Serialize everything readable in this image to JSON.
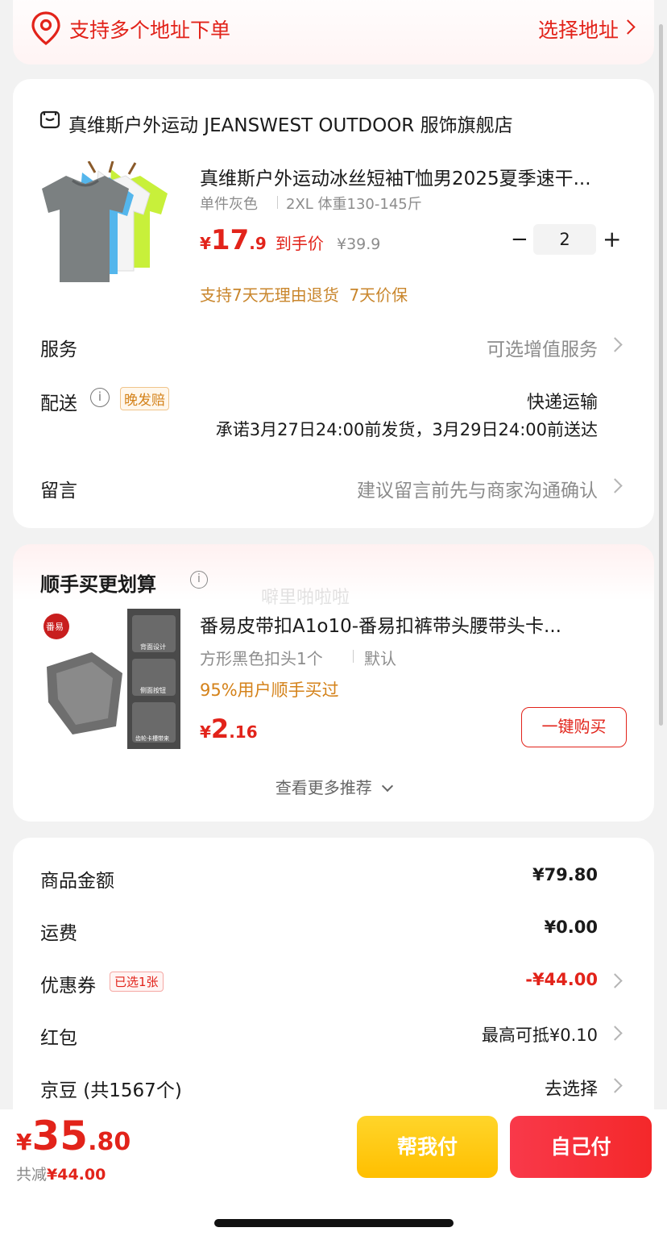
{
  "address_bar": {
    "label": "支持多个地址下单",
    "action": "选择地址"
  },
  "store": {
    "name": "真维斯户外运动 JEANSWEST OUTDOOR 服饰旗舰店"
  },
  "product": {
    "title": "真维斯户外运动冰丝短袖T恤男2025夏季速干...",
    "spec_color": "单件灰色",
    "spec_size": "2XL 体重130-145斤",
    "price_symbol": "¥",
    "price_int": "17",
    "price_dec": ".9",
    "price_tag": "到手价",
    "original_price": "¥39.9",
    "quantity": "2",
    "minus": "−",
    "plus": "+",
    "guarantee": "支持7天无理由退货  7天价保"
  },
  "service": {
    "label": "服务",
    "value": "可选增值服务"
  },
  "delivery": {
    "label": "配送",
    "badge": "晚发赔",
    "method": "快递运输",
    "promise": "承诺3月27日24:00前发货，3月29日24:00前送达"
  },
  "message": {
    "label": "留言",
    "placeholder": "建议留言前先与商家沟通确认"
  },
  "addon": {
    "title": "顺手买更划算",
    "watermark": "噼里啪啦啦",
    "product_title": "番易皮带扣A1o10-番易扣裤带头腰带头卡...",
    "spec": "方形黑色扣头1个",
    "spec2": "默认",
    "social_proof": "95%用户顺手买过",
    "price_symbol": "¥",
    "price_int": "2",
    "price_dec": ".16",
    "buy_button": "一键购买",
    "brand_logo": "番易",
    "image_labels": [
      "背面设计",
      "侧面按钮",
      "齿轮卡槽带来"
    ],
    "more": "查看更多推荐"
  },
  "summary": {
    "goods_label": "商品金额",
    "goods_value": "¥79.80",
    "shipping_label": "运费",
    "shipping_value": "¥0.00",
    "coupon_label": "优惠券",
    "coupon_badge": "已选1张",
    "coupon_value": "-¥44.00",
    "redpacket_label": "红包",
    "redpacket_value": "最高可抵¥0.10",
    "jingdou_label": "京豆 (共1567个)",
    "jingdou_value": "去选择"
  },
  "footer": {
    "total_symbol": "¥",
    "total_int": "35",
    "total_dec": ".80",
    "discount_label": "共减",
    "discount_value": "¥44.00",
    "help_pay": "帮我付",
    "self_pay": "自己付"
  },
  "colors": {
    "accent_red": "#e2231a",
    "orange": "#d4821a",
    "help_pay_yellow": "#ffc400",
    "self_pay_red": "#f4282a"
  }
}
